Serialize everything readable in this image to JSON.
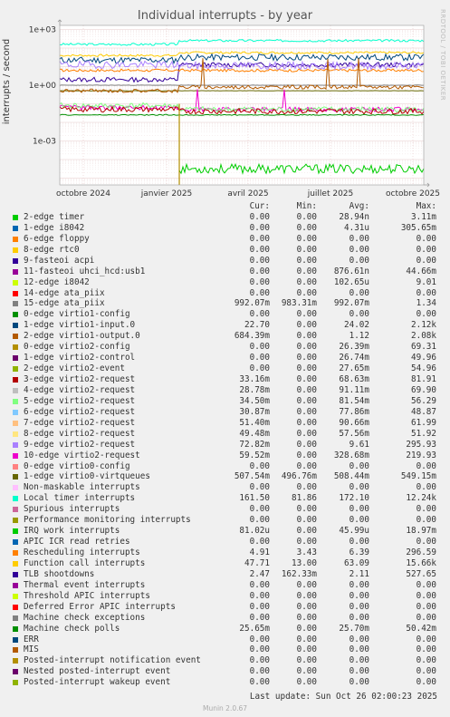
{
  "title": "Individual interrupts - by year",
  "side_label": "RRDTOOL / TOBI OETIKER",
  "footer": {
    "last_update": "Last update: Sun Oct 26 02:00:23 2025",
    "munin": "Munin 2.0.67"
  },
  "legend_header": [
    "Cur:",
    "Min:",
    "Avg:",
    "Max:"
  ],
  "chart_data": {
    "type": "line",
    "ylabel": "interrupts / second",
    "yscale": "log",
    "yticks": [
      "1e+03",
      "1e+00",
      "1e-03"
    ],
    "xticks": [
      "octobre 2024",
      "janvier 2025",
      "avril 2025",
      "juillet 2025",
      "octobre 2025"
    ],
    "grid": true,
    "series": [
      {
        "name": "2-edge timer",
        "color": "#00cc00",
        "cur": "0.00",
        "min": "0.00",
        "avg": "28.94n",
        "max": "3.11m"
      },
      {
        "name": "1-edge i8042",
        "color": "#0066b3",
        "cur": "0.00",
        "min": "0.00",
        "avg": "4.31u",
        "max": "305.65m"
      },
      {
        "name": "6-edge floppy",
        "color": "#ff8000",
        "cur": "0.00",
        "min": "0.00",
        "avg": "0.00",
        "max": "0.00"
      },
      {
        "name": "8-edge rtc0",
        "color": "#ffcc00",
        "cur": "0.00",
        "min": "0.00",
        "avg": "0.00",
        "max": "0.00"
      },
      {
        "name": "9-fasteoi acpi",
        "color": "#330099",
        "cur": "0.00",
        "min": "0.00",
        "avg": "0.00",
        "max": "0.00"
      },
      {
        "name": "11-fasteoi uhci_hcd:usb1",
        "color": "#990099",
        "cur": "0.00",
        "min": "0.00",
        "avg": "876.61n",
        "max": "44.66m"
      },
      {
        "name": "12-edge i8042",
        "color": "#ccff00",
        "cur": "0.00",
        "min": "0.00",
        "avg": "102.65u",
        "max": "9.01"
      },
      {
        "name": "14-edge ata_piix",
        "color": "#ff0000",
        "cur": "0.00",
        "min": "0.00",
        "avg": "0.00",
        "max": "0.00"
      },
      {
        "name": "15-edge ata_piix",
        "color": "#808080",
        "cur": "992.07m",
        "min": "983.31m",
        "avg": "992.07m",
        "max": "1.34"
      },
      {
        "name": "0-edge virtio1-config",
        "color": "#008f00",
        "cur": "0.00",
        "min": "0.00",
        "avg": "0.00",
        "max": "0.00"
      },
      {
        "name": "1-edge virtio1-input.0",
        "color": "#00487d",
        "cur": "22.70",
        "min": "0.00",
        "avg": "24.02",
        "max": "2.12k"
      },
      {
        "name": "2-edge virtio1-output.0",
        "color": "#b35a00",
        "cur": "684.39m",
        "min": "0.00",
        "avg": "1.12",
        "max": "2.08k"
      },
      {
        "name": "0-edge virtio2-config",
        "color": "#b38f00",
        "cur": "0.00",
        "min": "0.00",
        "avg": "26.39m",
        "max": "69.31"
      },
      {
        "name": "1-edge virtio2-control",
        "color": "#6b006b",
        "cur": "0.00",
        "min": "0.00",
        "avg": "26.74m",
        "max": "49.96"
      },
      {
        "name": "2-edge virtio2-event",
        "color": "#8fb300",
        "cur": "0.00",
        "min": "0.00",
        "avg": "27.65m",
        "max": "54.96"
      },
      {
        "name": "3-edge virtio2-request",
        "color": "#b30000",
        "cur": "33.16m",
        "min": "0.00",
        "avg": "68.63m",
        "max": "81.91"
      },
      {
        "name": "4-edge virtio2-request",
        "color": "#bebebe",
        "cur": "28.78m",
        "min": "0.00",
        "avg": "91.11m",
        "max": "69.90"
      },
      {
        "name": "5-edge virtio2-request",
        "color": "#80ff80",
        "cur": "34.50m",
        "min": "0.00",
        "avg": "81.54m",
        "max": "56.29"
      },
      {
        "name": "6-edge virtio2-request",
        "color": "#80c9ff",
        "cur": "30.87m",
        "min": "0.00",
        "avg": "77.86m",
        "max": "48.87"
      },
      {
        "name": "7-edge virtio2-request",
        "color": "#ffc080",
        "cur": "51.40m",
        "min": "0.00",
        "avg": "90.66m",
        "max": "61.99"
      },
      {
        "name": "8-edge virtio2-request",
        "color": "#ffe680",
        "cur": "49.48m",
        "min": "0.00",
        "avg": "57.56m",
        "max": "51.92"
      },
      {
        "name": "9-edge virtio2-request",
        "color": "#aa80ff",
        "cur": "72.82m",
        "min": "0.00",
        "avg": "9.61",
        "max": "295.93"
      },
      {
        "name": "10-edge virtio2-request",
        "color": "#ee00cc",
        "cur": "59.52m",
        "min": "0.00",
        "avg": "328.68m",
        "max": "219.93"
      },
      {
        "name": "0-edge virtio0-config",
        "color": "#ff8080",
        "cur": "0.00",
        "min": "0.00",
        "avg": "0.00",
        "max": "0.00"
      },
      {
        "name": "1-edge virtio0-virtqueues",
        "color": "#666600",
        "cur": "507.54m",
        "min": "496.76m",
        "avg": "508.44m",
        "max": "549.15m"
      },
      {
        "name": "Non-maskable interrupts",
        "color": "#ffbfff",
        "cur": "0.00",
        "min": "0.00",
        "avg": "0.00",
        "max": "0.00"
      },
      {
        "name": "Local timer interrupts",
        "color": "#00ffcc",
        "cur": "161.50",
        "min": "81.86",
        "avg": "172.10",
        "max": "12.24k"
      },
      {
        "name": "Spurious interrupts",
        "color": "#cc6699",
        "cur": "0.00",
        "min": "0.00",
        "avg": "0.00",
        "max": "0.00"
      },
      {
        "name": "Performance monitoring interrupts",
        "color": "#999900",
        "cur": "0.00",
        "min": "0.00",
        "avg": "0.00",
        "max": "0.00"
      },
      {
        "name": "IRQ work interrupts",
        "color": "#00cc00",
        "cur": "81.02u",
        "min": "0.00",
        "avg": "45.99u",
        "max": "18.97m"
      },
      {
        "name": "APIC ICR read retries",
        "color": "#0066b3",
        "cur": "0.00",
        "min": "0.00",
        "avg": "0.00",
        "max": "0.00"
      },
      {
        "name": "Rescheduling interrupts",
        "color": "#ff8000",
        "cur": "4.91",
        "min": "3.43",
        "avg": "6.39",
        "max": "296.59"
      },
      {
        "name": "Function call interrupts",
        "color": "#ffcc00",
        "cur": "47.71",
        "min": "13.00",
        "avg": "63.09",
        "max": "15.66k"
      },
      {
        "name": "TLB shootdowns",
        "color": "#330099",
        "cur": "2.47",
        "min": "162.33m",
        "avg": "2.11",
        "max": "527.65"
      },
      {
        "name": "Thermal event interrupts",
        "color": "#990099",
        "cur": "0.00",
        "min": "0.00",
        "avg": "0.00",
        "max": "0.00"
      },
      {
        "name": "Threshold APIC interrupts",
        "color": "#ccff00",
        "cur": "0.00",
        "min": "0.00",
        "avg": "0.00",
        "max": "0.00"
      },
      {
        "name": "Deferred Error APIC interrupts",
        "color": "#ff0000",
        "cur": "0.00",
        "min": "0.00",
        "avg": "0.00",
        "max": "0.00"
      },
      {
        "name": "Machine check exceptions",
        "color": "#808080",
        "cur": "0.00",
        "min": "0.00",
        "avg": "0.00",
        "max": "0.00"
      },
      {
        "name": "Machine check polls",
        "color": "#008f00",
        "cur": "25.65m",
        "min": "0.00",
        "avg": "25.70m",
        "max": "50.42m"
      },
      {
        "name": "ERR",
        "color": "#00487d",
        "cur": "0.00",
        "min": "0.00",
        "avg": "0.00",
        "max": "0.00"
      },
      {
        "name": "MIS",
        "color": "#b35a00",
        "cur": "0.00",
        "min": "0.00",
        "avg": "0.00",
        "max": "0.00"
      },
      {
        "name": "Posted-interrupt notification event",
        "color": "#b38f00",
        "cur": "0.00",
        "min": "0.00",
        "avg": "0.00",
        "max": "0.00"
      },
      {
        "name": "Nested posted-interrupt event",
        "color": "#6b006b",
        "cur": "0.00",
        "min": "0.00",
        "avg": "0.00",
        "max": "0.00"
      },
      {
        "name": "Posted-interrupt wakeup event",
        "color": "#8fb300",
        "cur": "0.00",
        "min": "0.00",
        "avg": "0.00",
        "max": "0.00"
      }
    ]
  }
}
